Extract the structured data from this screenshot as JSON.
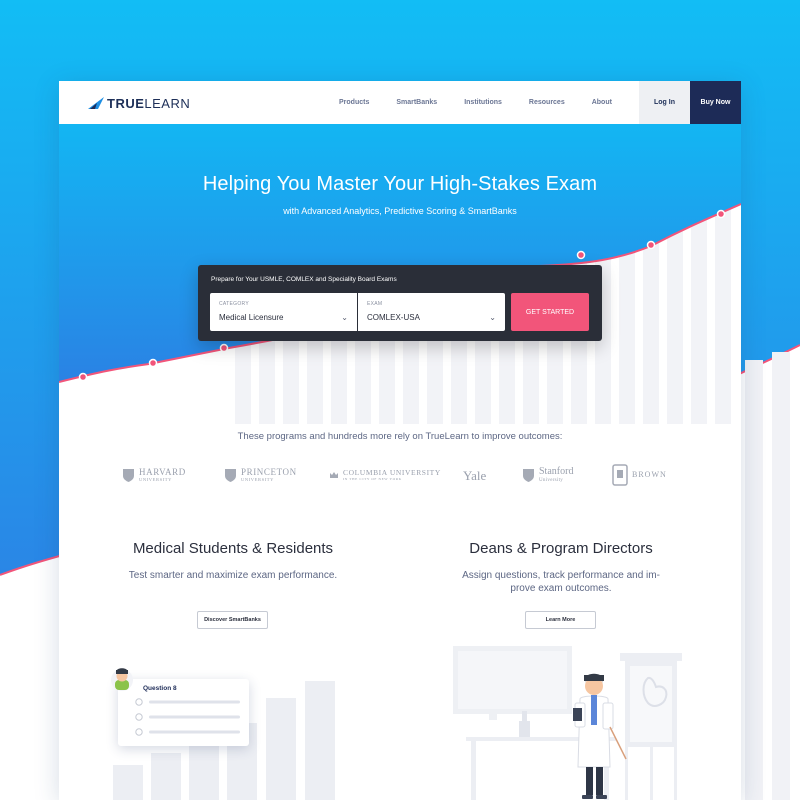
{
  "brand": {
    "name_bold": "TRUE",
    "name_light": "LEARN",
    "colors": {
      "hero_top": "#12b7f3",
      "hero_bottom": "#2b7fe0",
      "accent_pink": "#f2557a",
      "navy": "#1d2b57"
    }
  },
  "nav": {
    "links": [
      "Products",
      "SmartBanks",
      "Institutions",
      "Resources",
      "About"
    ],
    "login_label": "Log In",
    "buy_label": "Buy Now"
  },
  "hero": {
    "title": "Helping You Master Your High-Stakes Exam",
    "subtitle": "with Advanced Analytics, Predictive Scoring & SmartBanks"
  },
  "search": {
    "prompt": "Prepare  for Your USMLE, COMLEX and Speciality Board Exams",
    "category_label": "CATEGORY",
    "category_value": "Medical Licensure",
    "exam_label": "EXAM",
    "exam_value": "COMLEX-USA",
    "cta_label": "GET STARTED"
  },
  "trust": {
    "text": "These programs and hundreds more rely on TrueLearn to improve outcomes:",
    "universities": [
      {
        "main": "HARVARD",
        "small": "UNIVERSITY",
        "icon": "shield-icon"
      },
      {
        "main": "PRINCETON",
        "small": "UNIVERSITY",
        "icon": "shield-icon"
      },
      {
        "main": "COLUMBIA UNIVERSITY",
        "small": "IN THE CITY OF NEW YORK",
        "icon": "crown-icon"
      },
      {
        "main": "Yale",
        "small": "",
        "icon": ""
      },
      {
        "main": "Stanford",
        "small": "University",
        "icon": "tree-icon"
      },
      {
        "main": "BROWN",
        "small": "",
        "icon": "crest-icon"
      }
    ]
  },
  "columns": [
    {
      "title": "Medical Students & Residents",
      "desc_lines": [
        "Test smarter and maximize exam performance."
      ],
      "button": "Discover SmartBanks"
    },
    {
      "title": "Deans & Program Directors",
      "desc_lines": [
        "Assign questions, track performance and im-",
        "prove exam outcomes."
      ],
      "button": "Learn More"
    }
  ],
  "question_card": {
    "title": "Question 8"
  }
}
